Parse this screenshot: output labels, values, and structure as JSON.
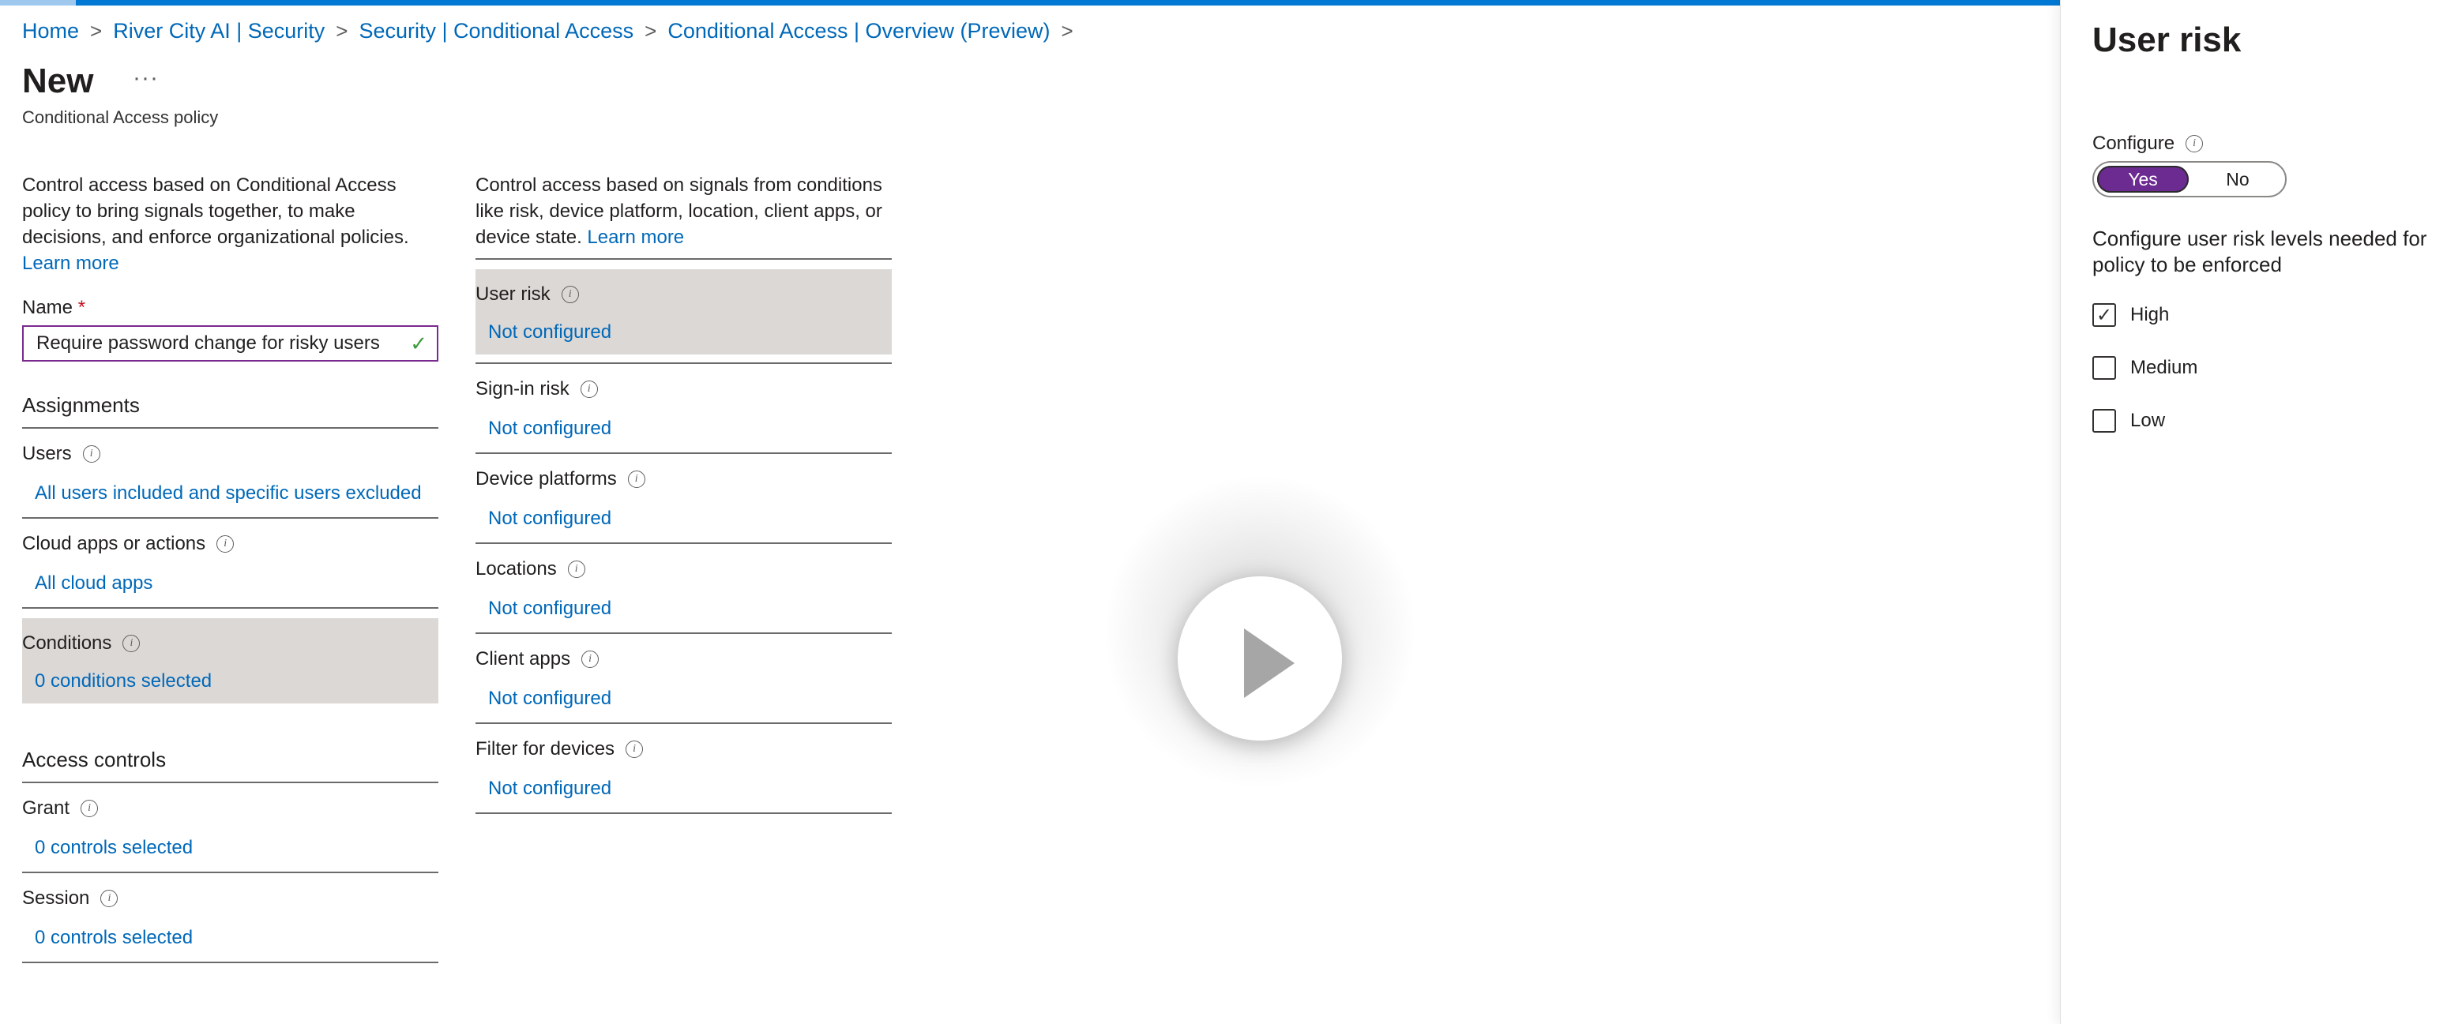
{
  "breadcrumb": {
    "items": [
      "Home",
      "River City AI | Security",
      "Security | Conditional Access",
      "Conditional Access | Overview (Preview)"
    ],
    "separator": ">"
  },
  "page": {
    "title": "New",
    "more": "···",
    "subtitle": "Conditional Access policy"
  },
  "left": {
    "description": "Control access based on Conditional Access policy to bring signals together, to make decisions, and enforce organizational policies.",
    "learn_more": "Learn more",
    "name_label": "Name",
    "required_mark": "*",
    "name_value": "Require password change for risky users",
    "assignments_heading": "Assignments",
    "assignments": [
      {
        "label": "Users",
        "value": "All users included and specific users excluded"
      },
      {
        "label": "Cloud apps or actions",
        "value": "All cloud apps"
      },
      {
        "label": "Conditions",
        "value": "0 conditions selected"
      }
    ],
    "access_heading": "Access controls",
    "access": [
      {
        "label": "Grant",
        "value": "0 controls selected"
      },
      {
        "label": "Session",
        "value": "0 controls selected"
      }
    ]
  },
  "conditions": {
    "description": "Control access based on signals from conditions like risk, device platform, location, client apps, or device state.",
    "learn_more": "Learn more",
    "items": [
      {
        "label": "User risk",
        "value": "Not configured"
      },
      {
        "label": "Sign-in risk",
        "value": "Not configured"
      },
      {
        "label": "Device platforms",
        "value": "Not configured"
      },
      {
        "label": "Locations",
        "value": "Not configured"
      },
      {
        "label": "Client apps",
        "value": "Not configured"
      },
      {
        "label": "Filter for devices",
        "value": "Not configured"
      }
    ]
  },
  "panel": {
    "title": "User risk",
    "configure_label": "Configure",
    "toggle": {
      "yes": "Yes",
      "no": "No",
      "selected": "Yes"
    },
    "risk_description": "Configure user risk levels needed for policy to be enforced",
    "levels": [
      {
        "label": "High",
        "checked": true
      },
      {
        "label": "Medium",
        "checked": false
      },
      {
        "label": "Low",
        "checked": false
      }
    ]
  },
  "icons": {
    "info": "info-icon",
    "check": "checkmark-icon",
    "play": "play-icon",
    "more": "more-options-icon"
  },
  "colors": {
    "link": "#0068b8",
    "accent": "#6b2b91",
    "topbar": "#0078d4",
    "highlight": "#dcd8d6"
  }
}
